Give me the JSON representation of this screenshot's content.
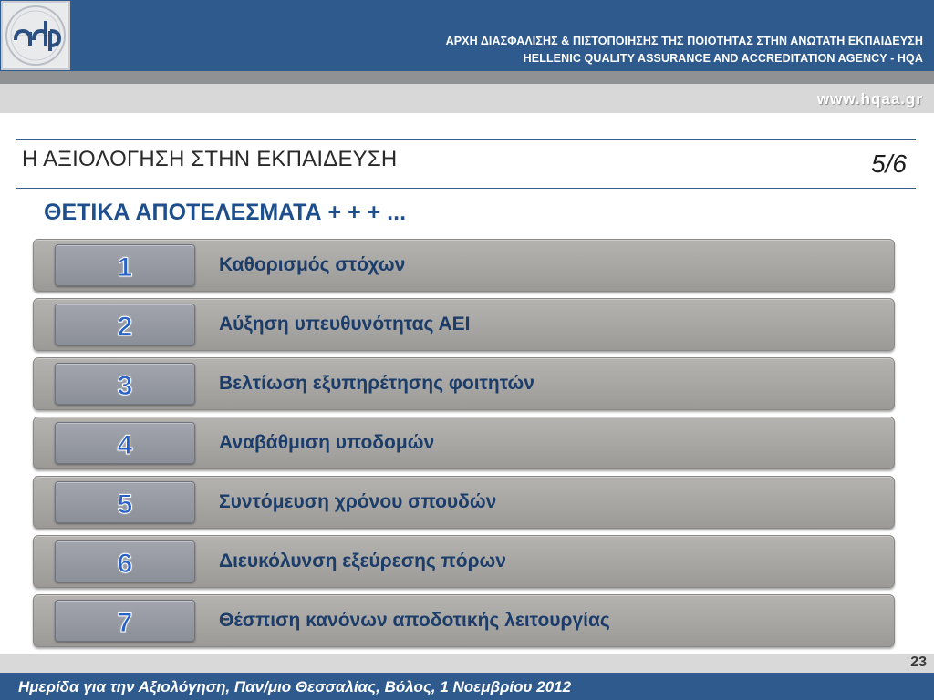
{
  "header": {
    "org_line_1": "ΑΡΧΗ ΔΙΑΣΦΑΛΙΣΗΣ & ΠΙΣΤΟΠΟΙΗΣΗΣ ΤΗΣ ΠΟΙΟΤΗΤΑΣ ΣΤΗΝ ΑΝΩΤΑΤΗ ΕΚΠΑΙΔΕΥΣΗ",
    "org_line_2": "HELLENIC QUALITY ASSURANCE AND ACCREDITATION AGENCY - HQA",
    "website": "www.hqaa.gr",
    "logo_icon": "adip-logo-icon"
  },
  "slide": {
    "title": "Η ΑΞΙΟΛΟΓΗΣΗ ΣΤΗΝ ΕΚΠΑΙΔΕΥΣΗ",
    "page_fraction": "5/6",
    "subtitle": "ΘΕΤΙΚΑ ΑΠΟΤΕΛΕΣΜΑΤΑ + + +  ..."
  },
  "items": [
    {
      "number": "1",
      "label": "Καθορισμός στόχων"
    },
    {
      "number": "2",
      "label": "Αύξηση υπευθυνότητας ΑΕΙ"
    },
    {
      "number": "3",
      "label": "Βελτίωση εξυπηρέτησης φοιτητών"
    },
    {
      "number": "4",
      "label": "Αναβάθμιση υποδομών"
    },
    {
      "number": "5",
      "label": "Συντόμευση χρόνου σπουδών"
    },
    {
      "number": "6",
      "label": "Διευκόλυνση εξεύρεσης πόρων"
    },
    {
      "number": "7",
      "label": "Θέσπιση κανόνων αποδοτικής λειτουργίας"
    }
  ],
  "footer": {
    "slide_number": "23",
    "event": "Ημερίδα για την Αξιολόγηση, Παν/μιο Θεσσαλίας, Βόλος, 1 Νοεμβρίου 2012"
  },
  "colors": {
    "brand_blue": "#2f5a8e",
    "subtitle_blue": "#1f4e8c",
    "number_blue": "#2a61c6"
  }
}
